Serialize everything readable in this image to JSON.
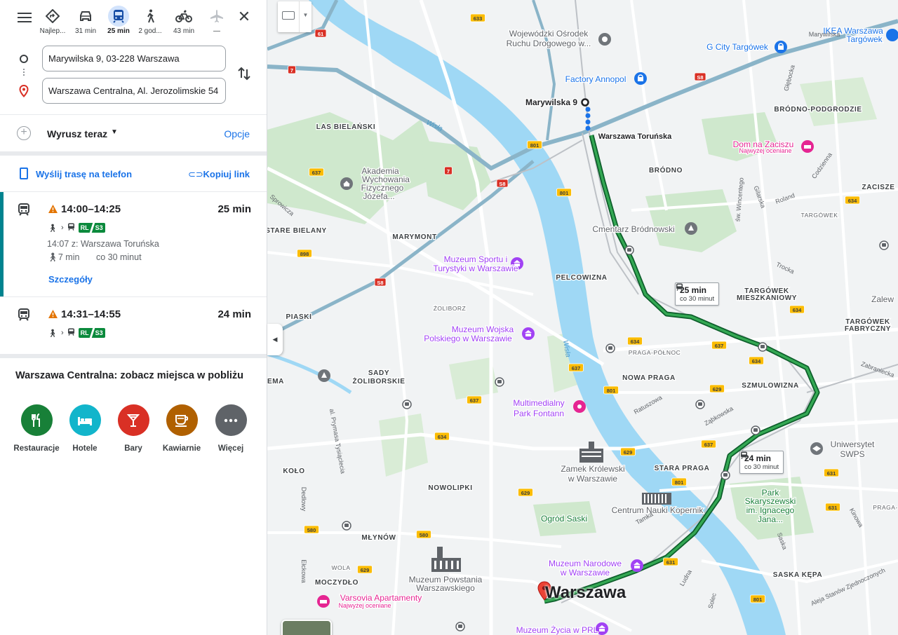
{
  "modes": [
    {
      "name": "best",
      "label": "Najlep..."
    },
    {
      "name": "car",
      "label": "31 min"
    },
    {
      "name": "transit",
      "label": "25 min",
      "active": true
    },
    {
      "name": "walk",
      "label": "2 god..."
    },
    {
      "name": "bike",
      "label": "43 min"
    },
    {
      "name": "flight",
      "label": "—"
    }
  ],
  "origin": {
    "value": "Marywilska 9, 03-228 Warszawa"
  },
  "destination": {
    "value": "Warszawa Centralna, Al. Jerozolimskie 54"
  },
  "depart": {
    "label": "Wyrusz teraz",
    "options_label": "Opcje"
  },
  "share": {
    "send": "Wyślij trasę na telefon",
    "copy": "Kopiuj link"
  },
  "trips": [
    {
      "time": "14:00–14:25",
      "duration": "25 min",
      "badge_a": "RL",
      "badge_b": "S3",
      "from": "14:07 z: Warszawa Toruńska",
      "walk": "7 min",
      "frequency": "co 30 minut",
      "details": "Szczegóły"
    },
    {
      "time": "14:31–14:55",
      "duration": "24 min",
      "badge_a": "RL",
      "badge_b": "S3"
    }
  ],
  "nearby": {
    "title": "Warszawa Centralna: zobacz miejsca w pobliżu",
    "categories": [
      {
        "label": "Restauracje",
        "icon": "fork-knife-icon",
        "color": "#188038"
      },
      {
        "label": "Hotele",
        "icon": "bed-icon",
        "color": "#12b5cb"
      },
      {
        "label": "Bary",
        "icon": "cocktail-icon",
        "color": "#d93025"
      },
      {
        "label": "Kawiarnie",
        "icon": "coffee-icon",
        "color": "#b06000"
      },
      {
        "label": "Więcej",
        "icon": "more-icon",
        "color": "#5f6368"
      }
    ]
  },
  "colors": {
    "accent": "#1a73e8",
    "selected_bar": "#00838f",
    "route": "#188038",
    "water": "#9fd8f5",
    "park": "#c8e6c9",
    "warning": "#e37400"
  },
  "map": {
    "callouts": [
      {
        "duration": "25 min",
        "frequency": "co 30 minut"
      },
      {
        "duration": "24 min",
        "frequency": "co 30 minut"
      }
    ],
    "city_label": "Warszawa",
    "labels": [
      {
        "text": "Wojewódzki Ośrodek",
        "cls": "poi"
      },
      {
        "text": "Ruchu Drogowego w...",
        "cls": "poi"
      },
      {
        "text": "Factory Annopol",
        "cls": "poi-blue"
      },
      {
        "text": "G City Targówek",
        "cls": "poi-blue"
      },
      {
        "text": "IKEA Warszawa",
        "cls": "poi-blue"
      },
      {
        "text": "Targówek",
        "cls": "poi-blue"
      },
      {
        "text": "Marywilska 9",
        "cls": "bold"
      },
      {
        "text": "Warszawa Toruńska",
        "cls": "bold-sm"
      },
      {
        "text": "BRÓDNO-PODGRODZIE",
        "cls": "district"
      },
      {
        "text": "LAS BIELAŃSKI",
        "cls": "district"
      },
      {
        "text": "Akademia",
        "cls": "poi"
      },
      {
        "text": "Wychowania",
        "cls": "poi"
      },
      {
        "text": "Fizycznego",
        "cls": "poi"
      },
      {
        "text": "Józefa...",
        "cls": "poi"
      },
      {
        "text": "Dom na Zaciszu",
        "cls": "poi-pink"
      },
      {
        "text": "Najwyżej oceniane",
        "cls": "poi-pink-sm"
      },
      {
        "text": "BRÓDNO",
        "cls": "district"
      },
      {
        "text": "ZACISZE",
        "cls": "district"
      },
      {
        "text": "STARE BIELANY",
        "cls": "district"
      },
      {
        "text": "Cmentarz Bródnowski",
        "cls": "poi"
      },
      {
        "text": "MARYMONT",
        "cls": "district"
      },
      {
        "text": "Muzeum Sportu i",
        "cls": "poi-purple"
      },
      {
        "text": "Turystyki w Warszawie",
        "cls": "poi-purple"
      },
      {
        "text": "PELCOWIZNA",
        "cls": "district"
      },
      {
        "text": "TARGÓWEK",
        "cls": "district"
      },
      {
        "text": "MIESZKANIOWY",
        "cls": "district"
      },
      {
        "text": "Zalew",
        "cls": "poi"
      },
      {
        "text": "TARGÓWEK",
        "cls": "district"
      },
      {
        "text": "FABRYCZNY",
        "cls": "district"
      },
      {
        "text": "PIASKI",
        "cls": "district"
      },
      {
        "text": "ŻOLIBORZ",
        "cls": "district-sm"
      },
      {
        "text": "Muzeum Wojska",
        "cls": "poi-purple"
      },
      {
        "text": "Polskiego w Warszawie",
        "cls": "poi-purple"
      },
      {
        "text": "PRAGA-PÓŁNOC",
        "cls": "district-sm"
      },
      {
        "text": "SADY",
        "cls": "district"
      },
      {
        "text": "ŻOLIBORSKIE",
        "cls": "district"
      },
      {
        "text": "EMA",
        "cls": "district"
      },
      {
        "text": "NOWA PRAGA",
        "cls": "district"
      },
      {
        "text": "SZMULOWIZNA",
        "cls": "district"
      },
      {
        "text": "Multimedialny",
        "cls": "poi-purple"
      },
      {
        "text": "Park Fontann",
        "cls": "poi-purple"
      },
      {
        "text": "Uniwersytet",
        "cls": "poi"
      },
      {
        "text": "SWPS",
        "cls": "poi"
      },
      {
        "text": "KOŁO",
        "cls": "district"
      },
      {
        "text": "Zamek Królewski",
        "cls": "poi"
      },
      {
        "text": "w Warszawie",
        "cls": "poi"
      },
      {
        "text": "STARA PRAGA",
        "cls": "district"
      },
      {
        "text": "NOWOLIPKI",
        "cls": "district"
      },
      {
        "text": "Centrum Nauki Kopernik",
        "cls": "poi"
      },
      {
        "text": "Park",
        "cls": "poi-green"
      },
      {
        "text": "Skaryszewski",
        "cls": "poi-green"
      },
      {
        "text": "im. Ignacego",
        "cls": "poi-green"
      },
      {
        "text": "Jana...",
        "cls": "poi-green"
      },
      {
        "text": "Ogród Saski",
        "cls": "poi-green"
      },
      {
        "text": "MŁYNÓW",
        "cls": "district"
      },
      {
        "text": "Muzeum Narodowe",
        "cls": "poi-purple"
      },
      {
        "text": "w Warszawie",
        "cls": "poi-purple"
      },
      {
        "text": "MOCZYDŁO",
        "cls": "district"
      },
      {
        "text": "Muzeum Powstania",
        "cls": "poi"
      },
      {
        "text": "Warszawskiego",
        "cls": "poi"
      },
      {
        "text": "SASKA KĘPA",
        "cls": "district"
      },
      {
        "text": "Varsovia Apartamenty",
        "cls": "poi-pink"
      },
      {
        "text": "Najwyżej oceniane",
        "cls": "poi-pink-sm"
      },
      {
        "text": "Muzeum Życia w PRL",
        "cls": "poi-purple"
      },
      {
        "text": "WOLA",
        "cls": "district-sm"
      },
      {
        "text": "TARGÓWEK",
        "cls": "district-sm"
      },
      {
        "text": "PRAGA-",
        "cls": "district-sm"
      }
    ],
    "streets": [
      {
        "text": "Wisła",
        "cls": "water"
      },
      {
        "text": "Wisła",
        "cls": "water"
      },
      {
        "text": "Marywilska"
      },
      {
        "text": "Roland"
      },
      {
        "text": "Trocka"
      },
      {
        "text": "Ratuszowa"
      },
      {
        "text": "Ząbkowska"
      },
      {
        "text": "Zabraniecka"
      },
      {
        "text": "Tamka"
      },
      {
        "text": "Ludna"
      },
      {
        "text": "Solec"
      },
      {
        "text": "Kinowa"
      },
      {
        "text": "Saska"
      },
      {
        "text": "Aleja Stanów Zjednoczonych"
      },
      {
        "text": "Dedlowy"
      },
      {
        "text": "Ełckowa"
      },
      {
        "text": "Sprowicza"
      },
      {
        "text": "Głębocka"
      },
      {
        "text": "Codzienna"
      },
      {
        "text": "św. Wincentego"
      },
      {
        "text": "Gilarska"
      },
      {
        "text": "al. Prymasa Tysiąclecia"
      }
    ],
    "road_badges": [
      {
        "text": "633"
      },
      {
        "text": "61",
        "red": true
      },
      {
        "text": "7",
        "red": true
      },
      {
        "text": "S8",
        "red": true
      },
      {
        "text": "801"
      },
      {
        "text": "637"
      },
      {
        "text": "7",
        "red": true
      },
      {
        "text": "S8",
        "red": true
      },
      {
        "text": "801"
      },
      {
        "text": "634"
      },
      {
        "text": "898"
      },
      {
        "text": "S8",
        "red": true
      },
      {
        "text": "634"
      },
      {
        "text": "634"
      },
      {
        "text": "637"
      },
      {
        "text": "634"
      },
      {
        "text": "801"
      },
      {
        "text": "637"
      },
      {
        "text": "629"
      },
      {
        "text": "634"
      },
      {
        "text": "637"
      },
      {
        "text": "629"
      },
      {
        "text": "801"
      },
      {
        "text": "637"
      },
      {
        "text": "629"
      },
      {
        "text": "631"
      },
      {
        "text": "580"
      },
      {
        "text": "580"
      },
      {
        "text": "629"
      },
      {
        "text": "631"
      },
      {
        "text": "801"
      },
      {
        "text": "631"
      }
    ]
  }
}
